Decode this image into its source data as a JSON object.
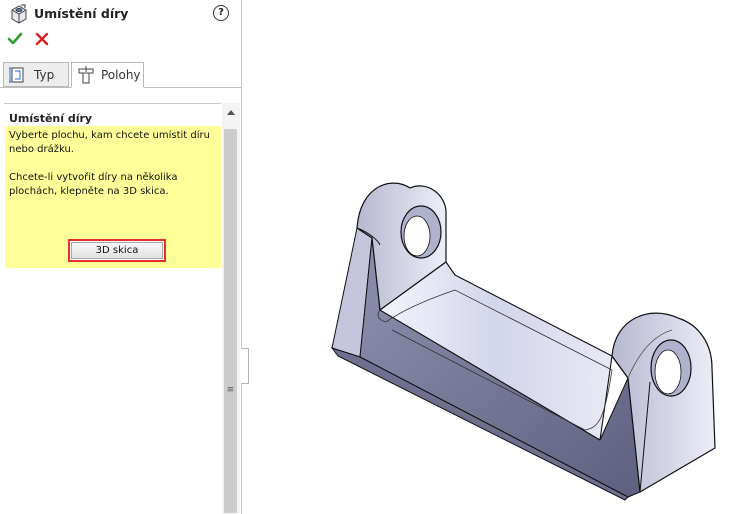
{
  "property_manager": {
    "title": "Umístění díry",
    "icons": {
      "feature": "hole-wizard-icon",
      "help": "help-icon",
      "ok": "checkmark-icon",
      "cancel": "close-icon"
    },
    "help_glyph": "?",
    "ok_glyph": "✔",
    "cancel_glyph": "✖",
    "tabs": [
      {
        "label": "Typ",
        "icon": "hole-type-icon",
        "active": false
      },
      {
        "label": "Polohy",
        "icon": "hole-position-icon",
        "active": true
      }
    ],
    "group": {
      "title": "Umístění díry",
      "hint_line1": "Vyberte plochu, kam chcete umístit díru nebo drážku.",
      "hint_line2": "Chcete-li vytvořit díry na několika plochách, klepněte na 3D skica.",
      "button_label": "3D skica"
    },
    "grip_glyph": "≡"
  },
  "colors": {
    "hint_background": "#ffff99",
    "highlight_border": "#e53030",
    "ok_green": "#2e9b2e",
    "cancel_red": "#d42020",
    "part_face": "#d4d5e8",
    "part_edge": "#101010"
  },
  "viewport": {
    "model": "bracket-part-with-two-holed-lugs"
  }
}
